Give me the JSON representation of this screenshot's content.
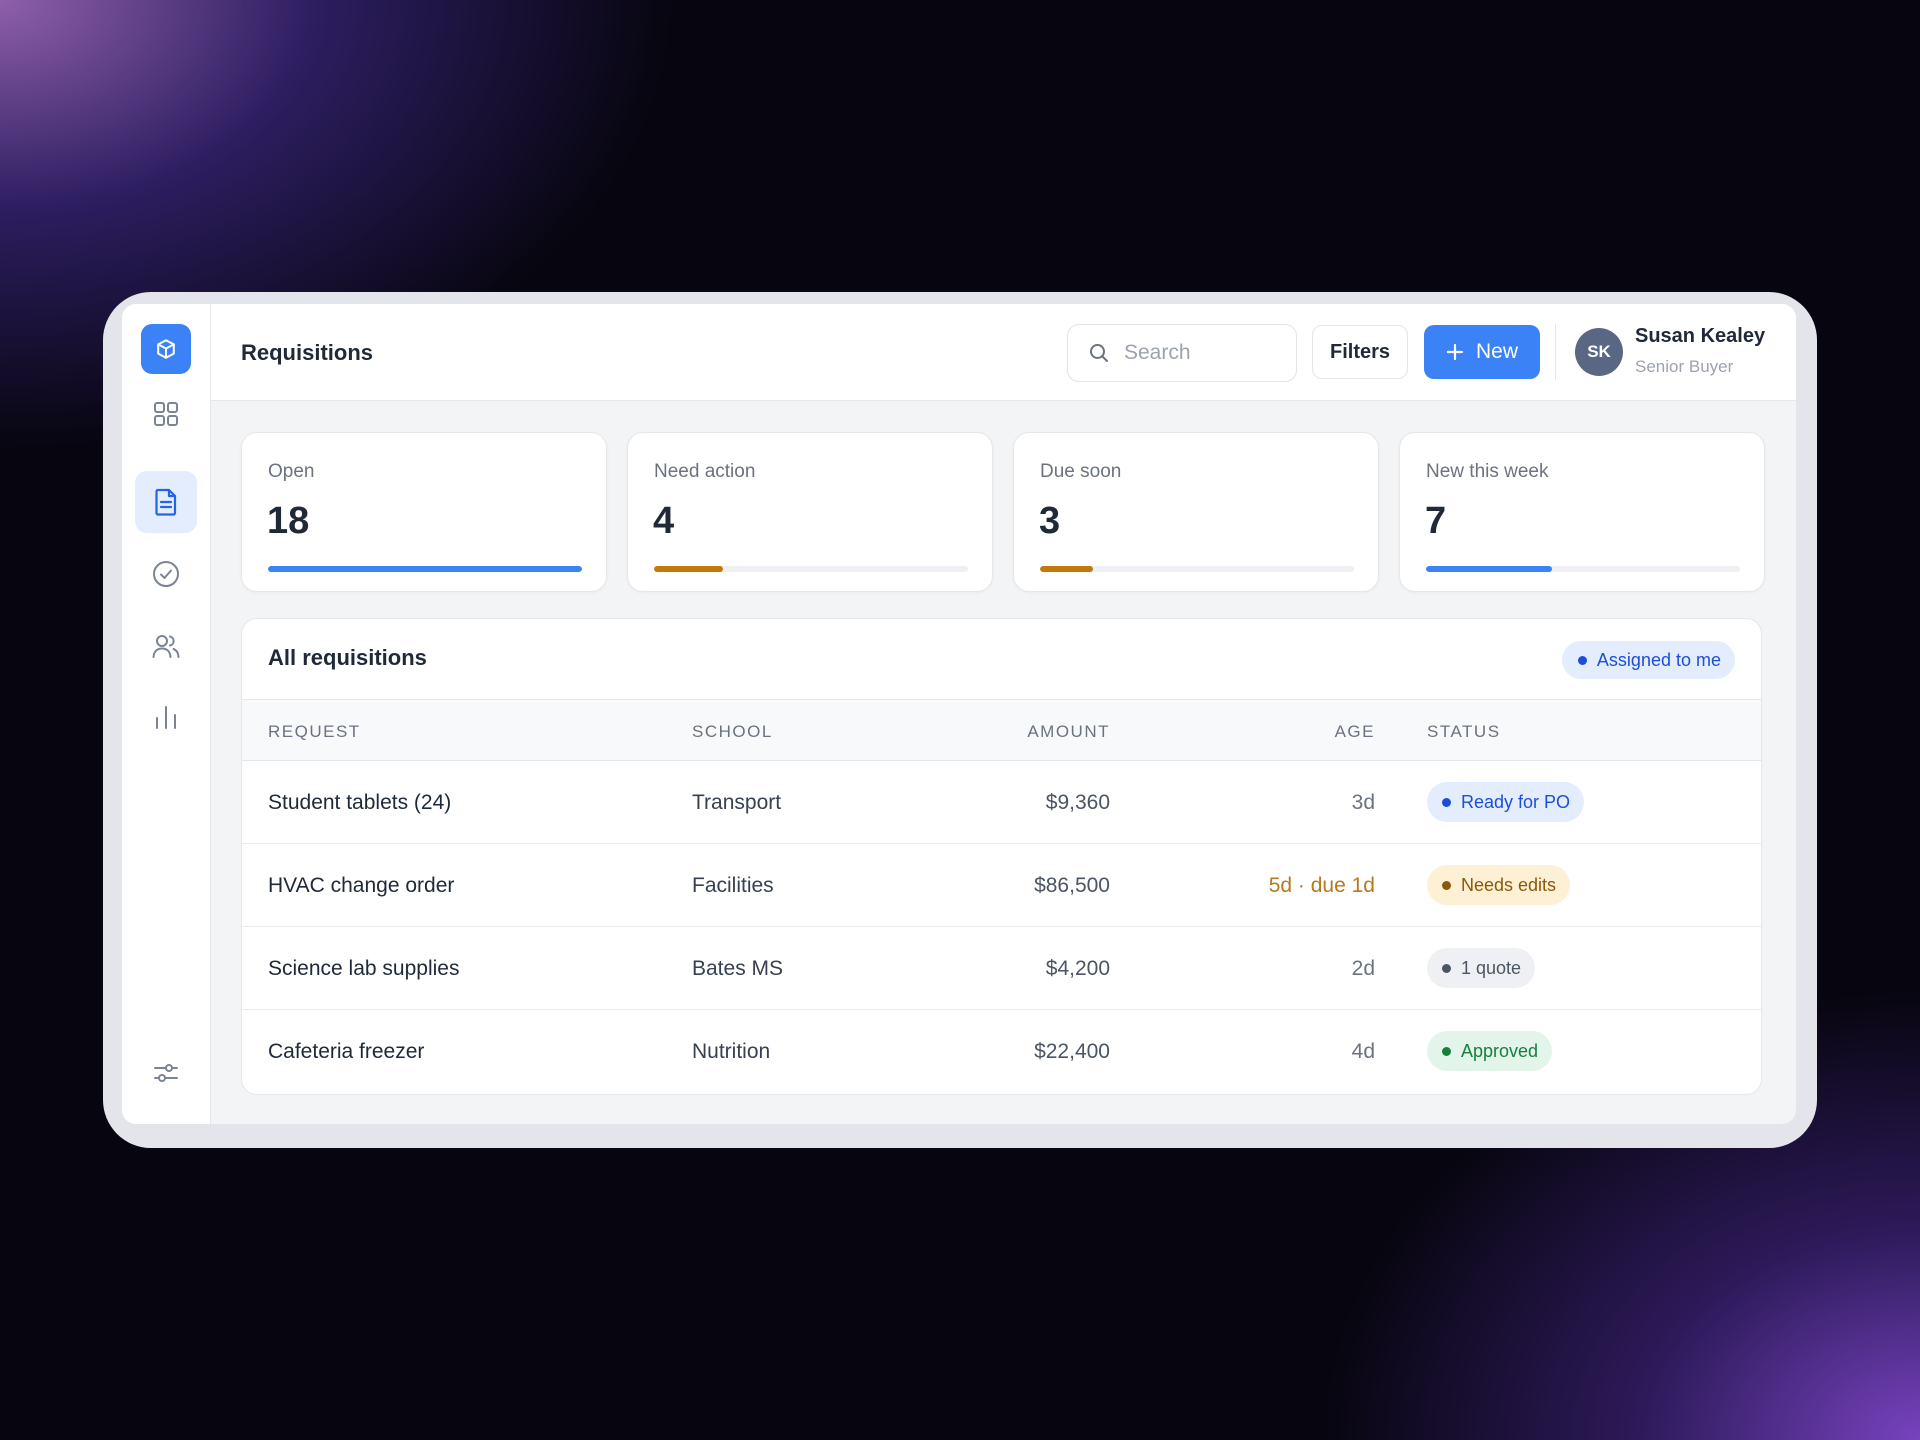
{
  "header": {
    "title": "Requisitions",
    "search_placeholder": "Search",
    "filters_label": "Filters",
    "new_label": "New"
  },
  "user": {
    "initials": "SK",
    "name": "Susan Kealey",
    "role": "Senior Buyer"
  },
  "sidebar": {
    "items": [
      {
        "name": "dashboard",
        "icon": "grid-icon",
        "active": false
      },
      {
        "name": "requisitions",
        "icon": "document-icon",
        "active": true
      },
      {
        "name": "approvals",
        "icon": "check-circle-icon",
        "active": false
      },
      {
        "name": "vendors",
        "icon": "users-icon",
        "active": false
      },
      {
        "name": "reports",
        "icon": "bar-chart-icon",
        "active": false
      }
    ],
    "bottom_icon": "sliders-icon"
  },
  "stats": [
    {
      "label": "Open",
      "value": "18",
      "progress": 1.0,
      "color": "#3b82f6"
    },
    {
      "label": "Need action",
      "value": "4",
      "progress": 0.22,
      "color": "#c2790a"
    },
    {
      "label": "Due soon",
      "value": "3",
      "progress": 0.17,
      "color": "#c2790a"
    },
    {
      "label": "New this week",
      "value": "7",
      "progress": 0.4,
      "color": "#3b82f6"
    }
  ],
  "table": {
    "title": "All requisitions",
    "filter_chip": "Assigned to me",
    "columns": {
      "request": "REQUEST",
      "school": "SCHOOL",
      "amount": "AMOUNT",
      "age": "AGE",
      "status": "STATUS"
    },
    "rows": [
      {
        "request": "Student tablets (24)",
        "school": "Transport",
        "amount": "$9,360",
        "age": "3d",
        "status": "Ready for PO"
      },
      {
        "request": "HVAC change order",
        "school": "Facilities",
        "amount": "$86,500",
        "age": "5d · due 1d",
        "status": "Needs edits"
      },
      {
        "request": "Science lab supplies",
        "school": "Bates MS",
        "amount": "$4,200",
        "age": "2d",
        "status": "1 quote"
      },
      {
        "request": "Cafeteria freezer",
        "school": "Nutrition",
        "amount": "$22,400",
        "age": "4d",
        "status": "Approved"
      }
    ]
  },
  "colors": {
    "accent": "#3b82f6",
    "warning": "#c2790a",
    "success": "#15803d",
    "neutral": "#4b5563"
  }
}
